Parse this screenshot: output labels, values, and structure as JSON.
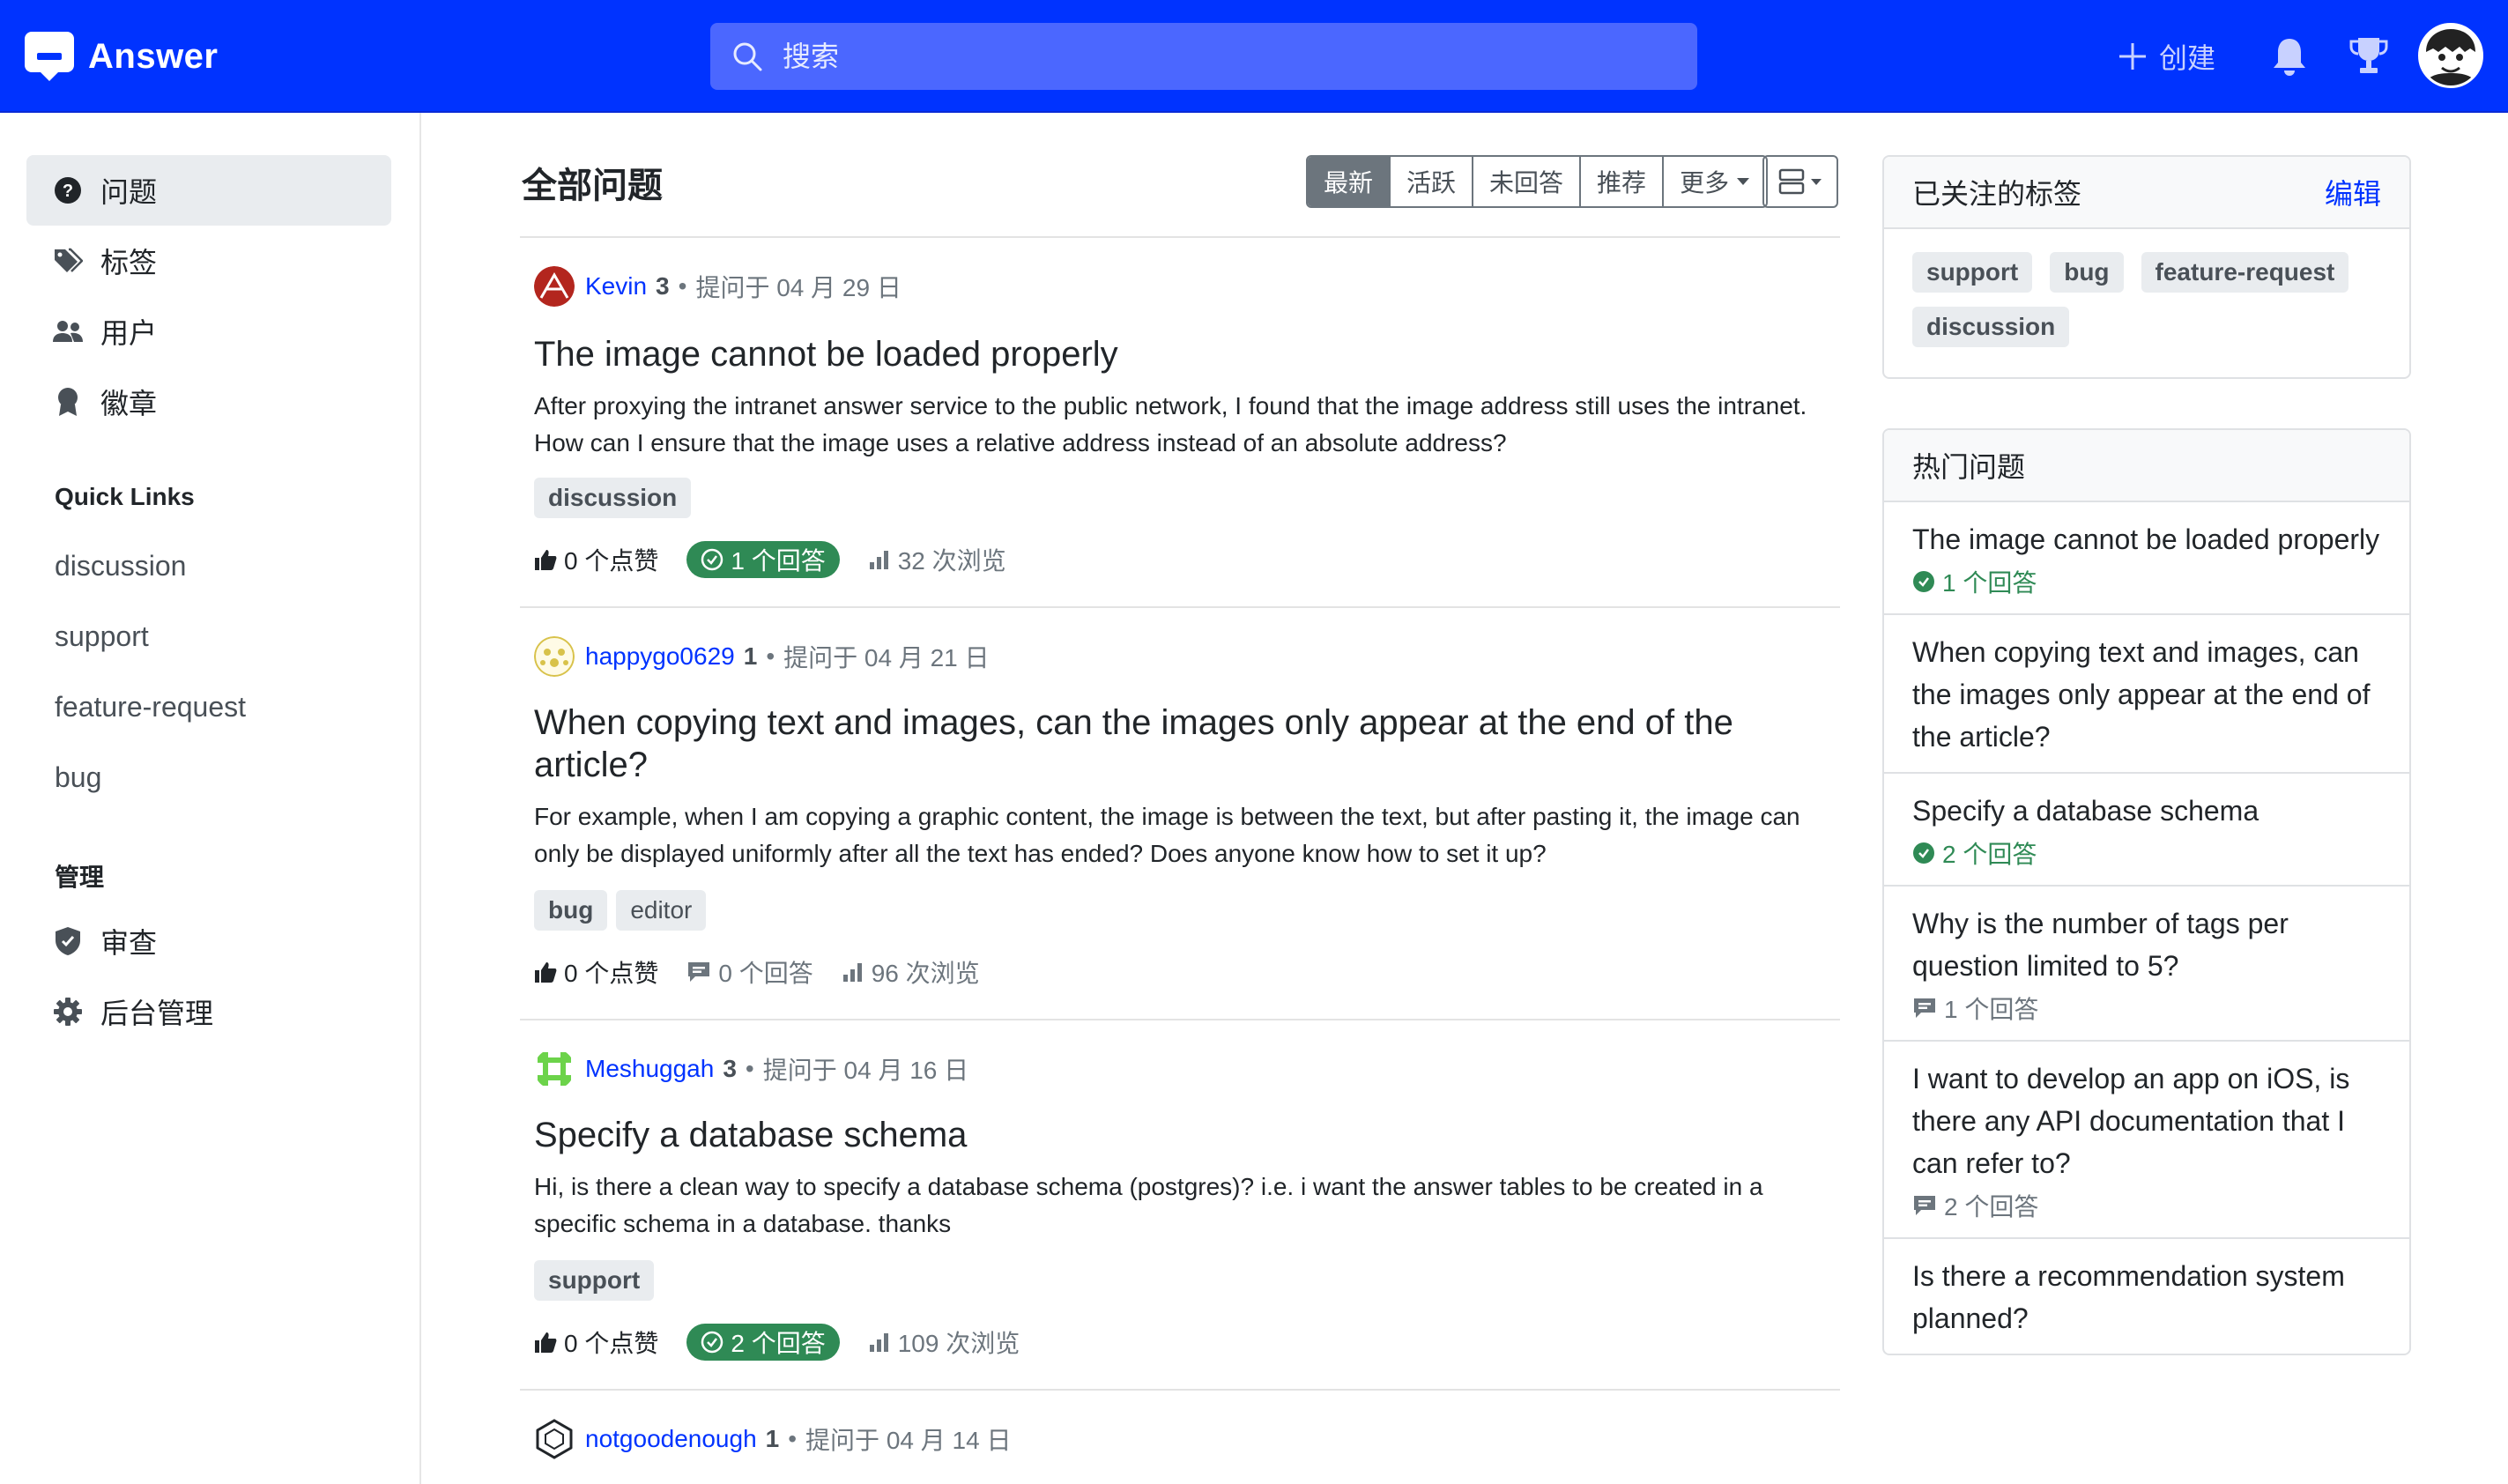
{
  "header": {
    "app_name": "Answer",
    "search_placeholder": "搜索",
    "create_label": "创建",
    "brand_color": "#0033ff",
    "icons": [
      "answer-logo-icon",
      "search-icon",
      "plus-icon",
      "bell-icon",
      "trophy-icon",
      "user-avatar"
    ]
  },
  "sidebar": {
    "nav": [
      {
        "label": "问题",
        "icon": "question-circle-icon",
        "active": true
      },
      {
        "label": "标签",
        "icon": "tags-icon",
        "active": false
      },
      {
        "label": "用户",
        "icon": "people-icon",
        "active": false
      },
      {
        "label": "徽章",
        "icon": "award-icon",
        "active": false
      }
    ],
    "quick_links_heading": "Quick Links",
    "quick_links": [
      "discussion",
      "support",
      "feature-request",
      "bug"
    ],
    "admin_heading": "管理",
    "admin": [
      {
        "label": "审查",
        "icon": "shield-check-icon"
      },
      {
        "label": "后台管理",
        "icon": "gear-icon"
      }
    ]
  },
  "main": {
    "title": "全部问题",
    "sort_options": [
      "最新",
      "活跃",
      "未回答",
      "推荐",
      "更多"
    ],
    "active_sort": "最新",
    "questions": [
      {
        "user": "Kevin",
        "rep": "3",
        "asked": "提问于 04 月 29 日",
        "title": "The image cannot be loaded properly",
        "excerpt": "After proxying the intranet answer service to the public network, I found that the image address still uses the intranet. How can I ensure that the image uses a relative address instead of an absolute address?",
        "tags": [
          "discussion"
        ],
        "votes": "0 个点赞",
        "answers": "1 个回答",
        "answered": true,
        "views": "32 次浏览"
      },
      {
        "user": "happygo0629",
        "rep": "1",
        "asked": "提问于 04 月 21 日",
        "title": "When copying text and images, can the images only appear at the end of the article?",
        "excerpt": "For example, when I am copying a graphic content, the image is between the text, but after pasting it, the image can only be displayed uniformly after all the text has ended? Does anyone know how to set it up?",
        "tags": [
          "bug",
          "editor"
        ],
        "votes": "0 个点赞",
        "answers": "0 个回答",
        "answered": false,
        "views": "96 次浏览"
      },
      {
        "user": "Meshuggah",
        "rep": "3",
        "asked": "提问于 04 月 16 日",
        "title": "Specify a database schema",
        "excerpt": "Hi, is there a clean way to specify a database schema (postgres)? i.e. i want the answer tables to be created in a specific schema in a database. thanks",
        "tags": [
          "support"
        ],
        "votes": "0 个点赞",
        "answers": "2 个回答",
        "answered": true,
        "views": "109 次浏览"
      },
      {
        "user": "notgoodenough",
        "rep": "1",
        "asked": "提问于 04 月 14 日"
      }
    ]
  },
  "followed_tags": {
    "title": "已关注的标签",
    "edit_label": "编辑",
    "tags": [
      "support",
      "bug",
      "feature-request",
      "discussion"
    ]
  },
  "hot_questions": {
    "title": "热门问题",
    "items": [
      {
        "title": "The image cannot be loaded properly",
        "answers": "1 个回答",
        "answered": true
      },
      {
        "title": "When copying text and images, can the images only appear at the end of the article?",
        "answers": "",
        "answered": false
      },
      {
        "title": "Specify a database schema",
        "answers": "2 个回答",
        "answered": true
      },
      {
        "title": "Why is the number of tags per question limited to 5?",
        "answers": "1 个回答",
        "answered": false
      },
      {
        "title": "I want to develop an app on iOS, is there any API documentation that I can refer to?",
        "answers": "2 个回答",
        "answered": false
      },
      {
        "title": "Is there a recommendation system planned?",
        "answers": "",
        "answered": false
      }
    ]
  },
  "colors": {
    "answered_badge": "#2f8a55",
    "link": "#0033ff",
    "muted": "#6c757d"
  }
}
